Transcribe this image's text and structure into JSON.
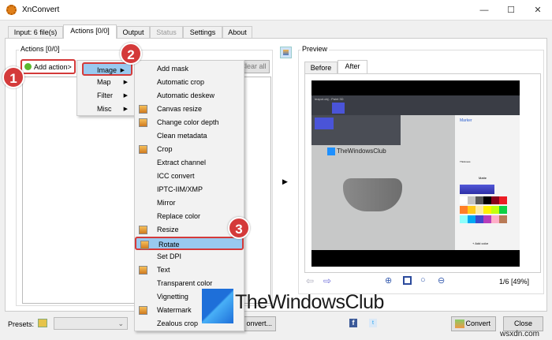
{
  "window": {
    "title": "XnConvert",
    "controls": [
      "—",
      "☐",
      "✕"
    ]
  },
  "tabs": [
    {
      "label": "Input: 6 file(s)"
    },
    {
      "label": "Actions [0/0]"
    },
    {
      "label": "Output"
    },
    {
      "label": "Status"
    },
    {
      "label": "Settings"
    },
    {
      "label": "About"
    }
  ],
  "actions": {
    "group_label": "Actions [0/0]",
    "add_action": "Add action>",
    "clear_all": "Clear all"
  },
  "menu_categories": [
    {
      "label": "Image"
    },
    {
      "label": "Map"
    },
    {
      "label": "Filter"
    },
    {
      "label": "Misc"
    }
  ],
  "image_submenu": [
    "Add mask",
    "Automatic crop",
    "Automatic deskew",
    "Canvas resize",
    "Change color depth",
    "Clean metadata",
    "Crop",
    "Extract channel",
    "ICC convert",
    "IPTC-IIM/XMP",
    "Mirror",
    "Replace color",
    "Resize",
    "Rotate",
    "Set DPI",
    "Text",
    "Transparent color",
    "Vignetting",
    "Watermark",
    "Zealous crop"
  ],
  "badges": [
    "1",
    "2",
    "3"
  ],
  "preview": {
    "group_label": "Preview",
    "tabs": [
      "Before",
      "After"
    ],
    "page_info": "1/6 [49%]",
    "image": {
      "title": "teapot.obj - Paint 3D",
      "watermark": "TheWindowsClub",
      "panel_title": "Marker",
      "thickness": "Thickness",
      "finish": "Matte",
      "add_color": "+ Add color",
      "colors": [
        "#ffffff",
        "#c3c3c3",
        "#585858",
        "#000000",
        "#88001b",
        "#ec1c24",
        "#ff7f27",
        "#ffca18",
        "#fdeca6",
        "#fff200",
        "#c4ff0e",
        "#0ed145",
        "#8cfffb",
        "#00a8f3",
        "#3f48cc",
        "#b83dba",
        "#ffaec8",
        "#b97a56"
      ]
    }
  },
  "bottom": {
    "presets_label": "Presets:",
    "convert_ellipsis": "onvert...",
    "convert": "Convert",
    "close": "Close"
  },
  "overlay": {
    "watermark": "TheWindowsClub",
    "site": "wsxdn.com"
  }
}
